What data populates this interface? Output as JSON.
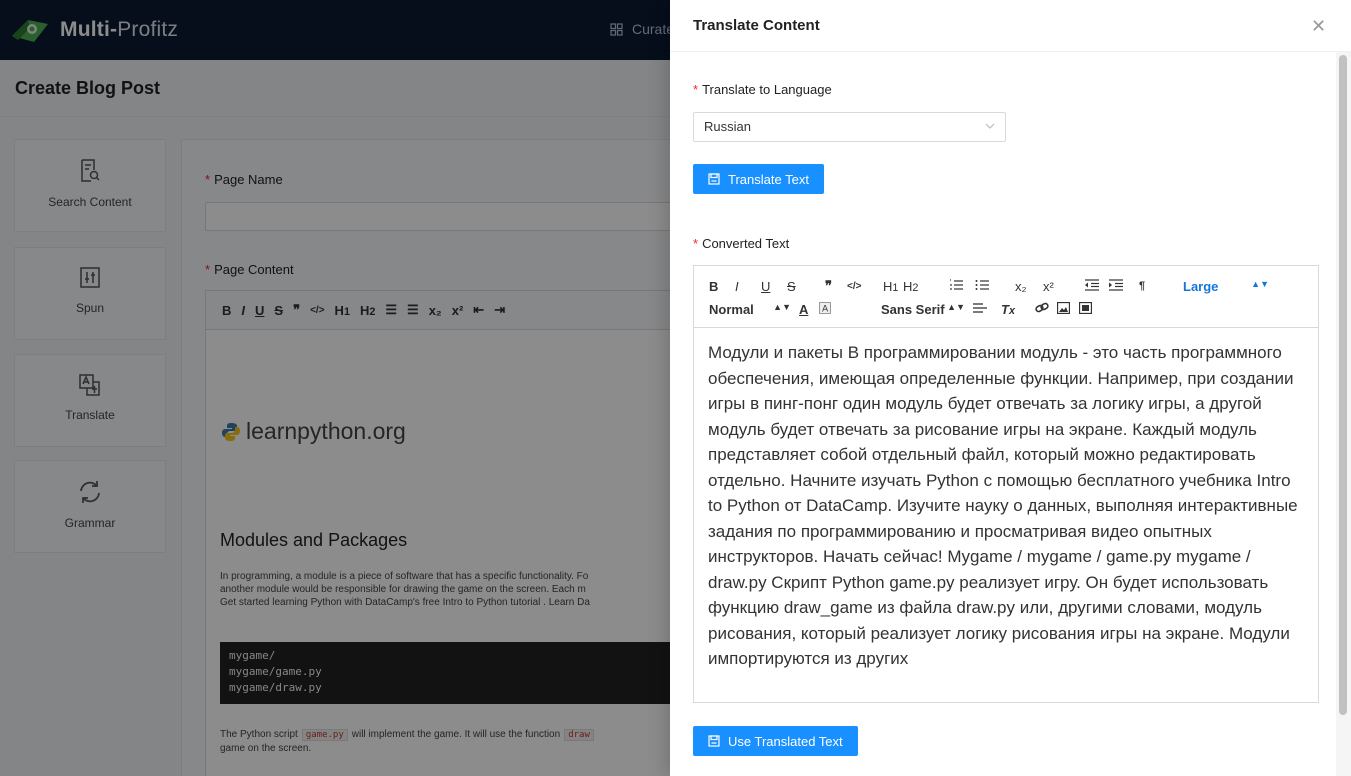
{
  "app": {
    "name_bold": "Multi-",
    "name_light": "Profitz"
  },
  "nav": {
    "curate_label": "Curate"
  },
  "page": {
    "title": "Create Blog Post"
  },
  "tools": [
    {
      "label": "Search Content",
      "icon": "search-document-icon"
    },
    {
      "label": "Spun",
      "icon": "sliders-icon"
    },
    {
      "label": "Translate",
      "icon": "translate-icon"
    },
    {
      "label": "Grammar",
      "icon": "refresh-icon"
    }
  ],
  "form": {
    "page_name_label": "Page Name",
    "page_content_label": "Page Content",
    "content": {
      "logo_text": "learnpython.org",
      "heading": "Modules and Packages",
      "paragraph": "In programming, a module is a piece of software that has a specific functionality. Fo\n another module would be responsible for drawing the game on the screen. Each m\nGet started learning Python with DataCamp's free Intro to Python tutorial . Learn Da",
      "code_lines": [
        "mygame/",
        "mygame/game.py",
        "mygame/draw.py"
      ],
      "para2_a": "The Python script",
      "para2_code": "game.py",
      "para2_b": "will implement the game. It will use the function",
      "para2_code2": "draw",
      "para2_c": "game on the screen."
    }
  },
  "drawer": {
    "title": "Translate Content",
    "close_glyph": "✕",
    "language_label": "Translate to Language",
    "language_value": "Russian",
    "translate_button": "Translate Text",
    "converted_label": "Converted Text",
    "use_button": "Use Translated Text",
    "toolbar": {
      "row1": [
        "B",
        "I",
        "U",
        "S",
        "❞",
        "</>",
        "H1",
        "H2",
        "ol",
        "ul",
        "x₂",
        "x²",
        "outdent",
        "indent",
        "¶"
      ],
      "size_select": "Large",
      "header_select": "Normal",
      "font_select": "Sans Serif"
    },
    "translated_text": "Модули и пакеты В программировании модуль - это часть программного обеспечения, имеющая определенные функции. Например, при создании игры в пинг-понг один модуль будет отвечать за логику игры, а другой модуль будет отвечать за рисование игры на экране. Каждый модуль представляет собой отдельный файл, который можно редактировать отдельно. Начните изучать Python с помощью бесплатного учебника Intro to Python от DataCamp. Изучите науку о данных, выполняя интерактивные задания по программированию и просматривая видео опытных инструкторов. Начать сейчас! Mygame / mygame / game.py mygame / draw.py Скрипт Python game.py реализует игру. Он будет использовать функцию draw_game из файла draw.py или, другими словами, модуль рисования, который реализует логику рисования игры на экране. Модули импортируются из других"
  },
  "colors": {
    "primary": "#1890ff",
    "topbar": "#0b1a33",
    "required": "#f5222d"
  }
}
